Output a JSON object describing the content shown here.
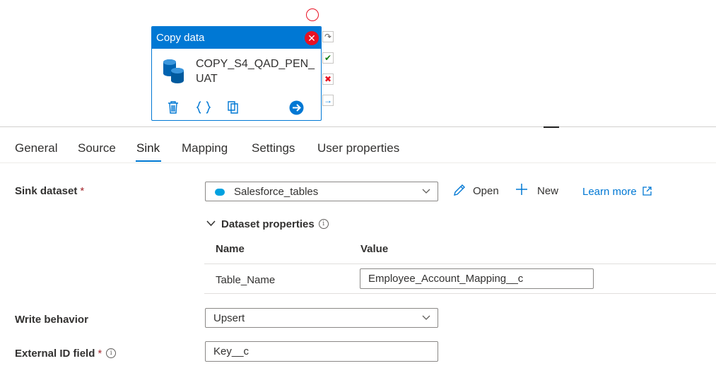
{
  "activity": {
    "header": "Copy data",
    "name": "COPY_S4_QAD_PEN_UAT"
  },
  "icons": {
    "close": "close-icon",
    "database": "database-icon",
    "delete": "delete-icon",
    "code": "code-icon",
    "copy": "copy-icon",
    "go": "arrow-right-circle-icon"
  },
  "tabs": [
    {
      "label": "General",
      "active": false
    },
    {
      "label": "Source",
      "active": false
    },
    {
      "label": "Sink",
      "active": true
    },
    {
      "label": "Mapping",
      "active": false
    },
    {
      "label": "Settings",
      "active": false
    },
    {
      "label": "User properties",
      "active": false
    }
  ],
  "sink": {
    "dataset_label": "Sink dataset",
    "required_mark": "*",
    "dataset_value": "Salesforce_tables",
    "open_label": "Open",
    "new_label": "New",
    "learn_more_label": "Learn more"
  },
  "dataset_properties": {
    "title": "Dataset properties",
    "col_name": "Name",
    "col_value": "Value",
    "rows": [
      {
        "name": "Table_Name",
        "value": "Employee_Account_Mapping__c"
      }
    ]
  },
  "write_behavior": {
    "label": "Write behavior",
    "value": "Upsert"
  },
  "external_id": {
    "label": "External ID field",
    "required_mark": "*",
    "value": "Key__c"
  },
  "colors": {
    "accent": "#0078d4",
    "error": "#e81123",
    "success": "#107c10"
  }
}
